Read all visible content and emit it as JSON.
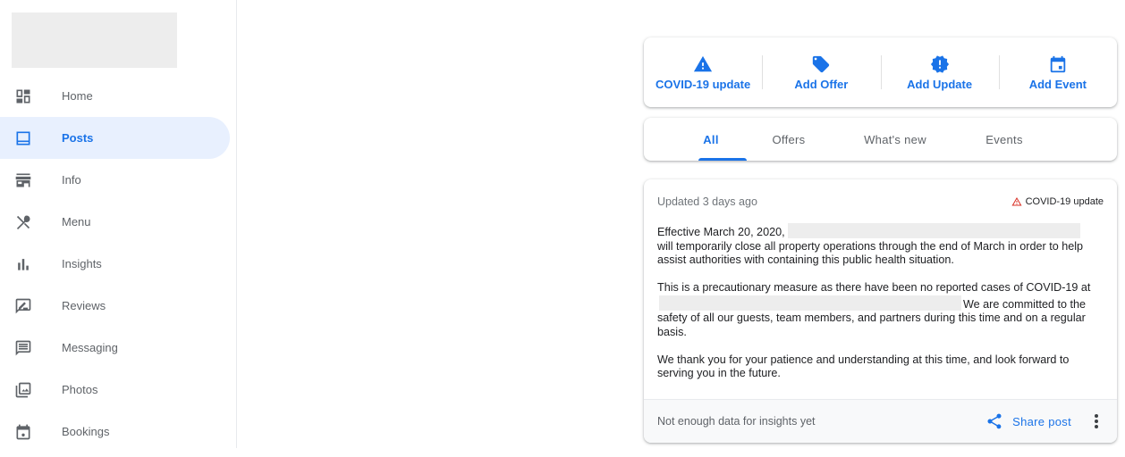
{
  "sidebar": {
    "items": [
      {
        "label": "Home",
        "icon": "dashboard-icon",
        "active": false
      },
      {
        "label": "Posts",
        "icon": "posts-icon",
        "active": true
      },
      {
        "label": "Info",
        "icon": "storefront-icon",
        "active": false
      },
      {
        "label": "Menu",
        "icon": "utensils-icon",
        "active": false
      },
      {
        "label": "Insights",
        "icon": "bar-chart-icon",
        "active": false
      },
      {
        "label": "Reviews",
        "icon": "rate-review-icon",
        "active": false
      },
      {
        "label": "Messaging",
        "icon": "chat-icon",
        "active": false
      },
      {
        "label": "Photos",
        "icon": "photo-library-icon",
        "active": false
      },
      {
        "label": "Bookings",
        "icon": "event-icon",
        "active": false
      }
    ]
  },
  "actions": [
    {
      "label": "COVID-19 update",
      "icon": "warning-icon"
    },
    {
      "label": "Add Offer",
      "icon": "tag-icon"
    },
    {
      "label": "Add Update",
      "icon": "new-releases-icon"
    },
    {
      "label": "Add Event",
      "icon": "calendar-icon"
    }
  ],
  "tabs": [
    {
      "label": "All",
      "active": true
    },
    {
      "label": "Offers",
      "active": false
    },
    {
      "label": "What's new",
      "active": false
    },
    {
      "label": "Events",
      "active": false
    }
  ],
  "post": {
    "updated": "Updated 3 days ago",
    "badge": "COVID-19 update",
    "p1_start": "Effective March 20, 2020,",
    "p1_rest": "will temporarily close all property operations through the end of March in order to help assist authorities with containing this public health situation.",
    "p2_start": "This is a precautionary measure as there have been no reported cases of COVID-19 at",
    "p2_rest": "We are committed to the safety of all our guests, team members, and partners during this time and on a regular basis.",
    "p3": "We thank you for your patience and understanding at this time, and look forward to serving you in the future.",
    "insights_note": "Not enough data for insights yet",
    "share_label": "Share post"
  },
  "colors": {
    "accent": "#1a73e8",
    "active_bg": "#e8f0fe",
    "warning": "#d93025"
  }
}
